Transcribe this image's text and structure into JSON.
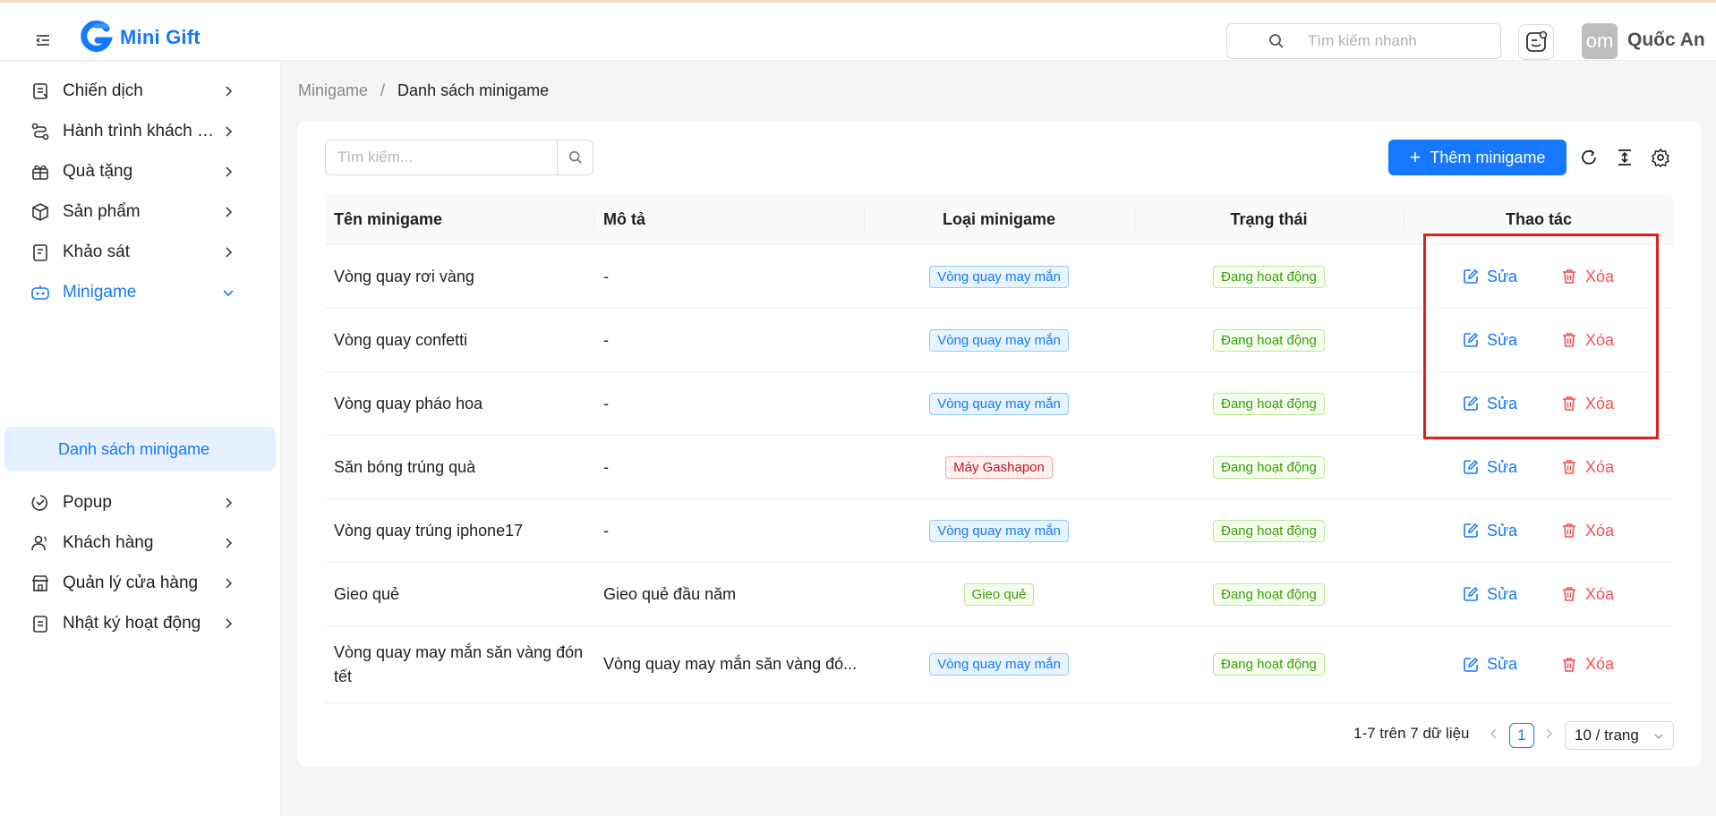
{
  "app": {
    "name": "Mini Gift",
    "brand_color": "#1677ff"
  },
  "header": {
    "search_placeholder": "Tìm kiếm nhanh",
    "avatar_text": "om",
    "user_name": "Quốc An"
  },
  "sidebar": {
    "items": [
      {
        "label": "Chiến dịch",
        "icon": "campaign-icon"
      },
      {
        "label": "Hành trình khách hàng",
        "icon": "journey-icon"
      },
      {
        "label": "Quà tặng",
        "icon": "gift-icon"
      },
      {
        "label": "Sản phẩm",
        "icon": "box-icon"
      },
      {
        "label": "Khảo sát",
        "icon": "survey-icon"
      },
      {
        "label": "Minigame",
        "icon": "gamepad-icon",
        "active": true
      },
      {
        "label": "Popup",
        "icon": "popup-icon"
      },
      {
        "label": "Khách hàng",
        "icon": "users-icon"
      },
      {
        "label": "Quản lý cửa hàng",
        "icon": "store-icon"
      },
      {
        "label": "Nhật ký hoạt động",
        "icon": "log-icon"
      }
    ],
    "subitem": "Danh sách minigame"
  },
  "breadcrumb": {
    "parent": "Minigame",
    "separator": "/",
    "current": "Danh sách minigame"
  },
  "toolbar": {
    "search_placeholder": "Tìm kiếm...",
    "add_label": "Thêm minigame"
  },
  "table": {
    "columns": [
      "Tên minigame",
      "Mô tả",
      "Loại minigame",
      "Trạng thái",
      "Thao tác"
    ],
    "edit_label": "Sửa",
    "delete_label": "Xóa",
    "rows": [
      {
        "name": "Vòng quay rơi vàng",
        "desc": "-",
        "type": "Vòng quay may mắn",
        "type_color": "blue",
        "status": "Đang hoạt động"
      },
      {
        "name": "Vòng quay confetti",
        "desc": "-",
        "type": "Vòng quay may mắn",
        "type_color": "blue",
        "status": "Đang hoạt động"
      },
      {
        "name": "Vòng quay pháo hoa",
        "desc": "-",
        "type": "Vòng quay may mắn",
        "type_color": "blue",
        "status": "Đang hoạt động"
      },
      {
        "name": "Săn bóng trúng quà",
        "desc": "-",
        "type": "Máy Gashapon",
        "type_color": "red",
        "status": "Đang hoạt động"
      },
      {
        "name": "Vòng quay trúng iphone17",
        "desc": "-",
        "type": "Vòng quay may mắn",
        "type_color": "blue",
        "status": "Đang hoạt động"
      },
      {
        "name": "Gieo quẻ",
        "desc": "Gieo quẻ đầu năm",
        "type": "Gieo quẻ",
        "type_color": "green",
        "status": "Đang hoạt động"
      },
      {
        "name": "Vòng quay may mắn săn vàng đón tết",
        "desc": "Vòng quay may mắn săn vàng đó...",
        "type": "Vòng quay may mắn",
        "type_color": "blue",
        "status": "Đang hoạt động"
      }
    ]
  },
  "pagination": {
    "total_text": "1-7 trên 7 dữ liệu",
    "current_page": "1",
    "page_size": "10 / trang"
  },
  "colors": {
    "primary": "#1677ff",
    "danger": "#ff4d4f",
    "success": "#389e0d",
    "highlight_box": "#e02020"
  }
}
